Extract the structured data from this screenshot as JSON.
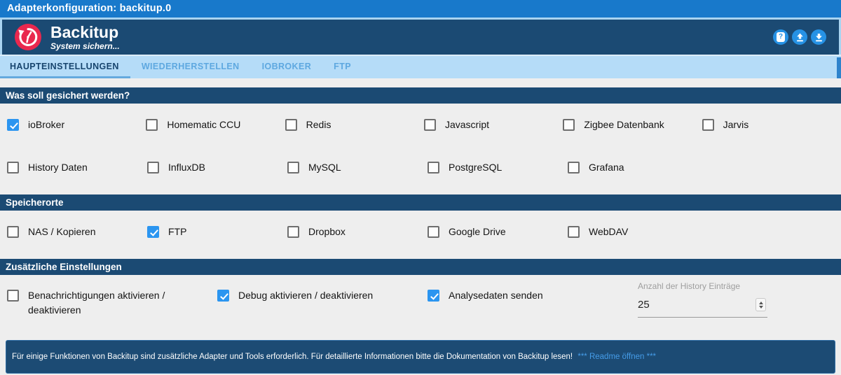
{
  "window": {
    "title": "Adapterkonfiguration: backitup.0"
  },
  "header": {
    "app_name": "Backitup",
    "subtitle": "System sichern...",
    "help_glyph": "?",
    "accent_color": "#2196f3",
    "navy_color": "#1b4a73",
    "logo_color": "#e9284e"
  },
  "tabs": {
    "active": "HAUPTEINSTELLUNGEN",
    "items": [
      {
        "label": "HAUPTEINSTELLUNGEN"
      },
      {
        "label": "WIEDERHERSTELLEN"
      },
      {
        "label": "IOBROKER"
      },
      {
        "label": "FTP"
      }
    ]
  },
  "sections": {
    "backup": {
      "title": "Was soll gesichert werden?",
      "row1": [
        {
          "label": "ioBroker",
          "checked": true
        },
        {
          "label": "Homematic CCU",
          "checked": false
        },
        {
          "label": "Redis",
          "checked": false
        },
        {
          "label": "Javascript",
          "checked": false
        },
        {
          "label": "Zigbee Datenbank",
          "checked": false
        },
        {
          "label": "Jarvis",
          "checked": false
        }
      ],
      "row2": [
        {
          "label": "History Daten",
          "checked": false
        },
        {
          "label": "InfluxDB",
          "checked": false
        },
        {
          "label": "MySQL",
          "checked": false
        },
        {
          "label": "PostgreSQL",
          "checked": false
        },
        {
          "label": "Grafana",
          "checked": false
        }
      ]
    },
    "storage": {
      "title": "Speicherorte",
      "items": [
        {
          "label": "NAS / Kopieren",
          "checked": false
        },
        {
          "label": "FTP",
          "checked": true
        },
        {
          "label": "Dropbox",
          "checked": false
        },
        {
          "label": "Google Drive",
          "checked": false
        },
        {
          "label": "WebDAV",
          "checked": false
        }
      ]
    },
    "extra": {
      "title": "Zusätzliche Einstellungen",
      "items": [
        {
          "label": "Benachrichtigungen aktivieren / deaktivieren",
          "checked": false
        },
        {
          "label": "Debug aktivieren / deaktivieren",
          "checked": true
        },
        {
          "label": "Analysedaten senden",
          "checked": true
        }
      ],
      "history_entries": {
        "label": "Anzahl der History Einträge",
        "value": "25"
      }
    }
  },
  "footer": {
    "text": "Für einige Funktionen von Backitup sind zusätzliche Adapter und Tools erforderlich. Für detaillierte Informationen bitte die Dokumentation von Backitup lesen!",
    "link": "*** Readme öffnen ***"
  }
}
